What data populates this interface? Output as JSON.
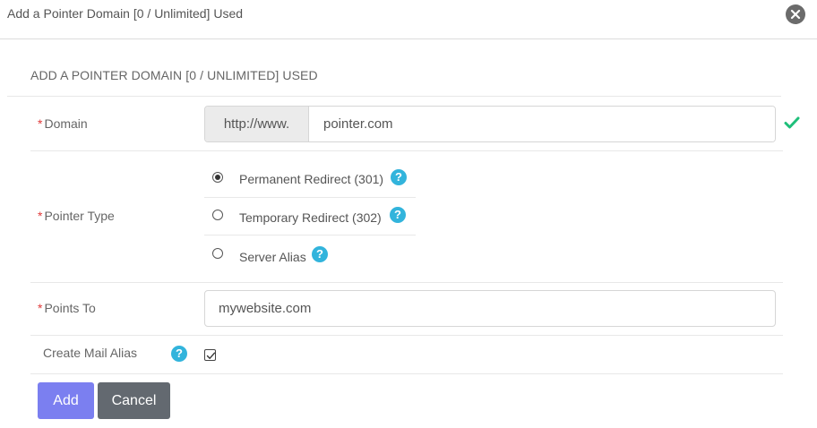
{
  "modal": {
    "title": "Add a Pointer Domain [0 / Unlimited] Used"
  },
  "form": {
    "section_title": "ADD A POINTER DOMAIN [0 / UNLIMITED] USED",
    "required_mark": "*",
    "domain": {
      "label": "Domain",
      "prefix": "http://www.",
      "value": "pointer.com",
      "valid": true
    },
    "pointer_type": {
      "label": "Pointer Type",
      "options": [
        {
          "label": "Permanent Redirect (301)",
          "selected": true
        },
        {
          "label": "Temporary Redirect (302)",
          "selected": false
        },
        {
          "label": "Server Alias",
          "selected": false
        }
      ],
      "help_glyph": "?"
    },
    "points_to": {
      "label": "Points To",
      "value": "mywebsite.com"
    },
    "create_mail_alias": {
      "label": "Create Mail Alias",
      "checked": true
    },
    "buttons": {
      "add_label": "Add",
      "cancel_label": "Cancel"
    }
  },
  "icons": {
    "close": "close-icon",
    "valid": "check-icon",
    "help": "help-icon"
  },
  "colors": {
    "required": "#e03a3a",
    "valid_check": "#1fbf7a",
    "help": "#32b4dc",
    "primary_button": "#7b7ff0",
    "secondary_button": "#636970"
  }
}
